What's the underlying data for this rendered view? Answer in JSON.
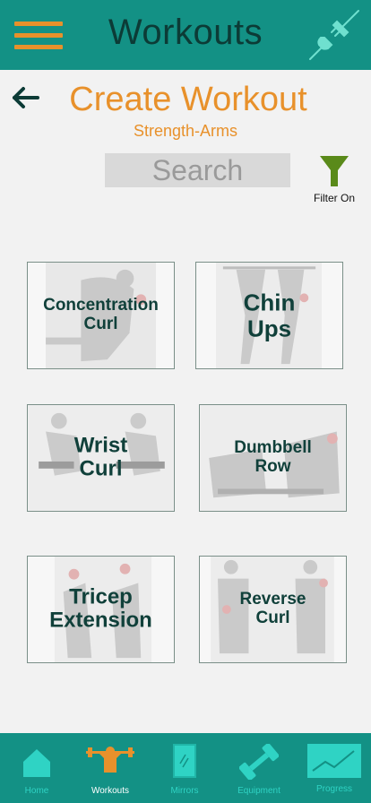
{
  "header": {
    "title": "Workouts",
    "menu_icon": "hamburger-icon",
    "right_icon": "plug-icon"
  },
  "page": {
    "title": "Create Workout",
    "subtitle": "Strength-Arms",
    "back_icon": "back-arrow-icon"
  },
  "search": {
    "placeholder": "Search"
  },
  "filter": {
    "label": "Filter On",
    "icon": "funnel-icon"
  },
  "exercises": [
    {
      "label_line1": "Concentration",
      "label_line2": "Curl"
    },
    {
      "label_line1": "Chin",
      "label_line2": "Ups"
    },
    {
      "label_line1": "Wrist",
      "label_line2": "Curl"
    },
    {
      "label_line1": "Dumbbell",
      "label_line2": "Row"
    },
    {
      "label_line1": "Tricep",
      "label_line2": "Extension"
    },
    {
      "label_line1": "Reverse",
      "label_line2": "Curl"
    }
  ],
  "nav": [
    {
      "label": "Home",
      "icon": "home-icon"
    },
    {
      "label": "Workouts",
      "icon": "weightlifter-icon",
      "active": true
    },
    {
      "label": "Mirrors",
      "icon": "mirror-icon"
    },
    {
      "label": "Equipment",
      "icon": "dumbbell-icon"
    },
    {
      "label": "Progress",
      "icon": "progress-chart-icon"
    }
  ],
  "colors": {
    "primary": "#139185",
    "accent": "#e8912b",
    "dark_text": "#0c3b36",
    "nav_label": "#2fd3c4"
  }
}
